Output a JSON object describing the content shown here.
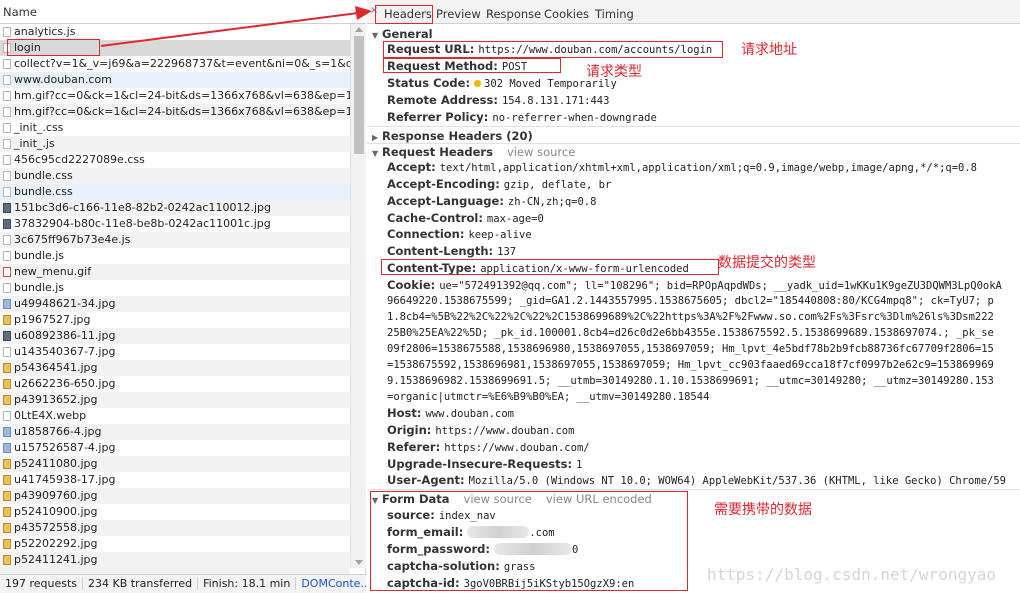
{
  "left": {
    "column_header": "Name",
    "requests": [
      {
        "name": "analytics.js",
        "icon": "doc"
      },
      {
        "name": "login",
        "icon": "doc"
      },
      {
        "name": "collect?v=1&_v=j69&a=222968737&t=event&ni=0&_s=1&dl=",
        "icon": "doc"
      },
      {
        "name": "www.douban.com",
        "icon": "doc"
      },
      {
        "name": "hm.gif?cc=0&ck=1&cl=24-bit&ds=1366x768&vl=638&ep=115",
        "icon": "doc"
      },
      {
        "name": "hm.gif?cc=0&ck=1&cl=24-bit&ds=1366x768&vl=638&ep=115",
        "icon": "doc"
      },
      {
        "name": "_init_.css",
        "icon": "doc"
      },
      {
        "name": "_init_.js",
        "icon": "doc"
      },
      {
        "name": "456c95cd2227089e.css",
        "icon": "doc"
      },
      {
        "name": "bundle.css",
        "icon": "doc"
      },
      {
        "name": "bundle.css",
        "icon": "doc"
      },
      {
        "name": "151bc3d6-c166-11e8-82b2-0242ac110012.jpg",
        "icon": "dark"
      },
      {
        "name": "37832904-b80c-11e8-be8b-0242ac11001c.jpg",
        "icon": "dark"
      },
      {
        "name": "3c675ff967b73e4e.js",
        "icon": "doc"
      },
      {
        "name": "bundle.js",
        "icon": "doc"
      },
      {
        "name": "new_menu.gif",
        "icon": "gif"
      },
      {
        "name": "bundle.js",
        "icon": "doc"
      },
      {
        "name": "u49948621-34.jpg",
        "icon": "img"
      },
      {
        "name": "p1967527.jpg",
        "icon": "ph"
      },
      {
        "name": "u60892386-11.jpg",
        "icon": "dark"
      },
      {
        "name": "u143540367-7.jpg",
        "icon": "doc"
      },
      {
        "name": "p54364541.jpg",
        "icon": "ph"
      },
      {
        "name": "u2662236-650.jpg",
        "icon": "ph"
      },
      {
        "name": "p43913652.jpg",
        "icon": "ph"
      },
      {
        "name": "0LtE4X.webp",
        "icon": "doc"
      },
      {
        "name": "u1858766-4.jpg",
        "icon": "img"
      },
      {
        "name": "u157526587-4.jpg",
        "icon": "img"
      },
      {
        "name": "p52411080.jpg",
        "icon": "ph"
      },
      {
        "name": "u41745938-17.jpg",
        "icon": "ph"
      },
      {
        "name": "p43909760.jpg",
        "icon": "ph"
      },
      {
        "name": "p52410900.jpg",
        "icon": "ph"
      },
      {
        "name": "p43572558.jpg",
        "icon": "ph"
      },
      {
        "name": "p52202292.jpg",
        "icon": "ph"
      },
      {
        "name": "p52411241.jpg",
        "icon": "ph"
      }
    ],
    "status": {
      "requests": "197 requests",
      "transferred": "234 KB transferred",
      "finish": "Finish: 18.1 min",
      "dom": "DOMConte..."
    }
  },
  "tabs": {
    "close": "×",
    "headers": "Headers",
    "preview": "Preview",
    "response": "Response",
    "cookies": "Cookies",
    "timing": "Timing"
  },
  "general": {
    "title": "General",
    "request_url_key": "Request URL:",
    "request_url": "https://www.douban.com/accounts/login",
    "request_method_key": "Request Method:",
    "request_method": "POST",
    "status_code_key": "Status Code:",
    "status_code": "302 Moved Temporarily",
    "remote_address_key": "Remote Address:",
    "remote_address": "154.8.131.171:443",
    "referrer_policy_key": "Referrer Policy:",
    "referrer_policy": "no-referrer-when-downgrade"
  },
  "response_headers": {
    "title": "Response Headers (20)"
  },
  "request_headers": {
    "title": "Request Headers",
    "view_source": "view source",
    "accept_key": "Accept:",
    "accept": "text/html,application/xhtml+xml,application/xml;q=0.9,image/webp,image/apng,*/*;q=0.8",
    "accept_encoding_key": "Accept-Encoding:",
    "accept_encoding": "gzip, deflate, br",
    "accept_language_key": "Accept-Language:",
    "accept_language": "zh-CN,zh;q=0.8",
    "cache_control_key": "Cache-Control:",
    "cache_control": "max-age=0",
    "connection_key": "Connection:",
    "connection": "keep-alive",
    "content_length_key": "Content-Length:",
    "content_length": "137",
    "content_type_key": "Content-Type:",
    "content_type": "application/x-www-form-urlencoded",
    "cookie_key": "Cookie:",
    "cookie_lines": [
      "ue=\"572491392@qq.com\"; ll=\"108296\"; bid=RPOpAqpdWDs; __yadk_uid=1wKKu1K9geZU3DQWM3LpQ0okA",
      "96649220.1538675599; _gid=GA1.2.1443557995.1538675605; dbcl2=\"185440808:80/KCG4mpq8\"; ck=TyU7; p",
      "1.8cb4=%5B%22%2C%22%2C%22%2C1538699689%2C%22https%3A%2F%2Fwww.so.com%2Fs%3Fsrc%3Dlm%26ls%3Dsm222",
      "25B0%25EA%22%5D; _pk_id.100001.8cb4=d26c0d2e6bb4355e.1538675592.5.1538699689.1538697074.; _pk_se",
      "09f2806=1538675588,1538696980,1538697055,1538697059; Hm_lpvt_4e5bdf78b2b9fcb88736fc67709f2806=15",
      "=1538675592,1538696981,1538697055,1538697059; Hm_lpvt_cc903faaed69cca18f7cf0997b2e62c9=153869969",
      "9.1538696982.1538699691.5; __utmb=30149280.1.10.1538699691; __utmc=30149280; __utmz=30149280.153",
      "=organic|utmctr=%E6%B9%B0%EA; __utmv=30149280.18544"
    ],
    "host_key": "Host:",
    "host": "www.douban.com",
    "origin_key": "Origin:",
    "origin": "https://www.douban.com",
    "referer_key": "Referer:",
    "referer": "https://www.douban.com/",
    "upgrade_key": "Upgrade-Insecure-Requests:",
    "upgrade": "1",
    "user_agent_key": "User-Agent:",
    "user_agent": "Mozilla/5.0 (Windows NT 10.0; WOW64) AppleWebKit/537.36 (KHTML, like Gecko) Chrome/59"
  },
  "form_data": {
    "title": "Form Data",
    "view_source": "view source",
    "view_url_encoded": "view URL encoded",
    "source_key": "source:",
    "source": "index_nav",
    "email_key": "form_email:",
    "email_suffix": ".com",
    "password_key": "form_password:",
    "password_suffix": "0",
    "captcha_solution_key": "captcha-solution:",
    "captcha_solution": "grass",
    "captcha_id_key": "captcha-id:",
    "captcha_id": "3goV0BRBij5iKStyb15OgzX9:en"
  },
  "annotations": {
    "request_url": "请求地址",
    "request_method": "请求类型",
    "content_type": "数据提交的类型",
    "form_data": "需要携带的数据"
  },
  "watermark": "https://blog.csdn.net/wrongyao",
  "colors": {
    "annotation_red": "#e0262f",
    "link_blue": "#1a55c9",
    "status_dot": "#f2b600"
  }
}
